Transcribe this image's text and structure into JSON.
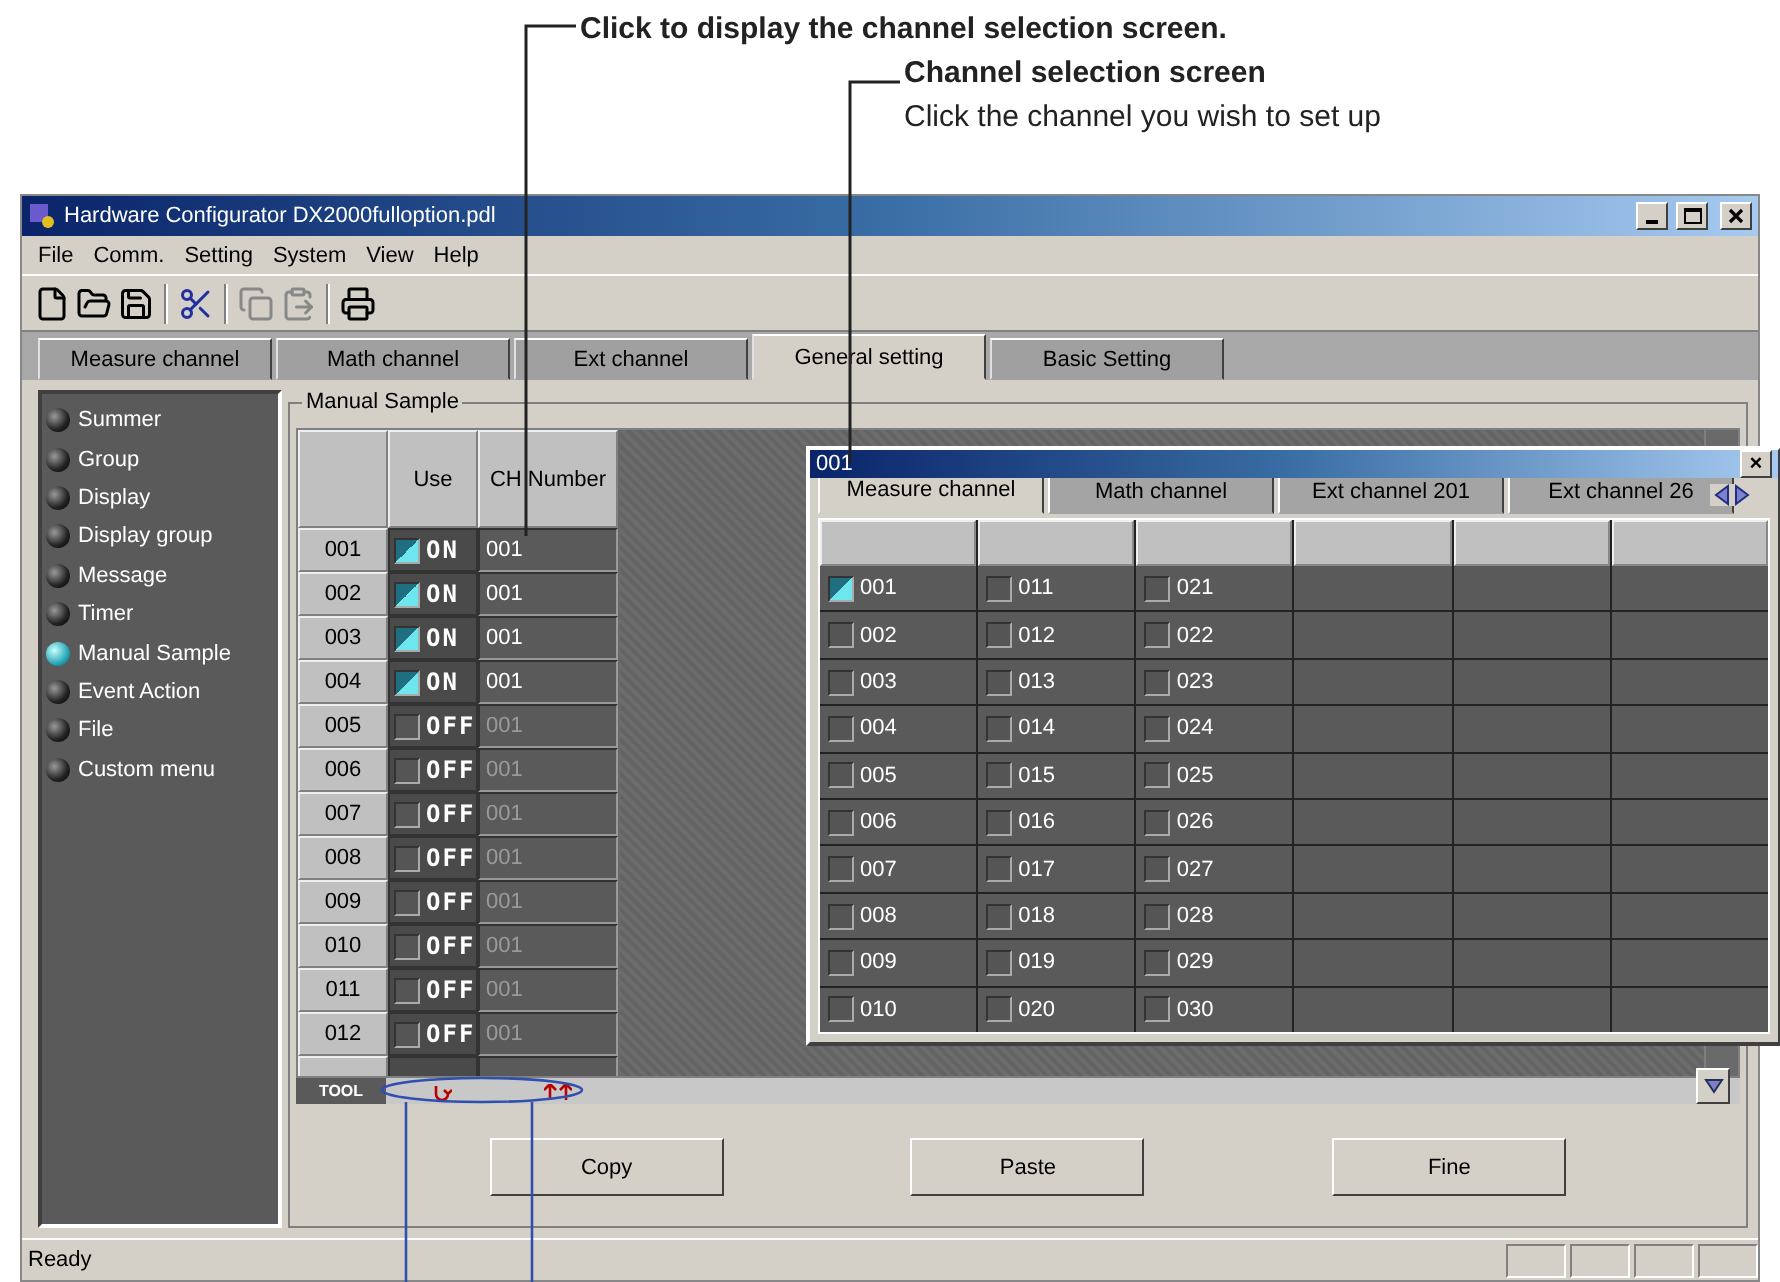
{
  "callouts": [
    {
      "kind": "heading",
      "text": "Click to display the channel selection screen."
    },
    {
      "kind": "heading",
      "text": "Channel selection screen"
    },
    {
      "kind": "body",
      "text": "Click the channel you wish to set up"
    }
  ],
  "window": {
    "title": "Hardware Configurator DX2000fulloption.pdl",
    "menu": [
      "File",
      "Comm.",
      "Setting",
      "System",
      "View",
      "Help"
    ],
    "tabs": [
      {
        "label": "Measure channel",
        "selected": false
      },
      {
        "label": "Math channel",
        "selected": false
      },
      {
        "label": "Ext channel",
        "selected": false
      },
      {
        "label": "General setting",
        "selected": true
      },
      {
        "label": "Basic Setting",
        "selected": false
      }
    ],
    "sidebar": {
      "items": [
        {
          "label": "Summer",
          "selected": false
        },
        {
          "label": "Group",
          "selected": false
        },
        {
          "label": "Display",
          "selected": false
        },
        {
          "label": "Display group",
          "selected": false
        },
        {
          "label": "Message",
          "selected": false
        },
        {
          "label": "Timer",
          "selected": false
        },
        {
          "label": "Manual Sample",
          "selected": true
        },
        {
          "label": "Event Action",
          "selected": false
        },
        {
          "label": "File",
          "selected": false
        },
        {
          "label": "Custom menu",
          "selected": false
        }
      ]
    },
    "group_title": "Manual Sample",
    "table": {
      "columns": [
        "Use",
        "CH Number"
      ],
      "rows": [
        {
          "id": "001",
          "on": true,
          "use_label": "ON",
          "ch": "001"
        },
        {
          "id": "002",
          "on": true,
          "use_label": "ON",
          "ch": "001"
        },
        {
          "id": "003",
          "on": true,
          "use_label": "ON",
          "ch": "001"
        },
        {
          "id": "004",
          "on": true,
          "use_label": "ON",
          "ch": "001"
        },
        {
          "id": "005",
          "on": false,
          "use_label": "OFF",
          "ch": "001"
        },
        {
          "id": "006",
          "on": false,
          "use_label": "OFF",
          "ch": "001"
        },
        {
          "id": "007",
          "on": false,
          "use_label": "OFF",
          "ch": "001"
        },
        {
          "id": "008",
          "on": false,
          "use_label": "OFF",
          "ch": "001"
        },
        {
          "id": "009",
          "on": false,
          "use_label": "OFF",
          "ch": "001"
        },
        {
          "id": "010",
          "on": false,
          "use_label": "OFF",
          "ch": "001"
        },
        {
          "id": "011",
          "on": false,
          "use_label": "OFF",
          "ch": "001"
        },
        {
          "id": "012",
          "on": false,
          "use_label": "OFF",
          "ch": "001"
        }
      ],
      "tool_label": "TOOL"
    },
    "buttons": [
      "Copy",
      "Paste",
      "Fine"
    ],
    "status_bar": "Ready"
  },
  "popup": {
    "title": "001",
    "close": "×",
    "tabs": [
      {
        "label": "Measure channel",
        "selected": true
      },
      {
        "label": "Math channel",
        "selected": false
      },
      {
        "label": "Ext channel 201",
        "selected": false
      },
      {
        "label": "Ext channel 26",
        "selected": false
      }
    ],
    "columns": [
      [
        {
          "label": "001",
          "checked": true
        },
        {
          "label": "002",
          "checked": false
        },
        {
          "label": "003",
          "checked": false
        },
        {
          "label": "004",
          "checked": false
        },
        {
          "label": "005",
          "checked": false
        },
        {
          "label": "006",
          "checked": false
        },
        {
          "label": "007",
          "checked": false
        },
        {
          "label": "008",
          "checked": false
        },
        {
          "label": "009",
          "checked": false
        },
        {
          "label": "010",
          "checked": false
        }
      ],
      [
        {
          "label": "011",
          "checked": false
        },
        {
          "label": "012",
          "checked": false
        },
        {
          "label": "013",
          "checked": false
        },
        {
          "label": "014",
          "checked": false
        },
        {
          "label": "015",
          "checked": false
        },
        {
          "label": "016",
          "checked": false
        },
        {
          "label": "017",
          "checked": false
        },
        {
          "label": "018",
          "checked": false
        },
        {
          "label": "019",
          "checked": false
        },
        {
          "label": "020",
          "checked": false
        }
      ],
      [
        {
          "label": "021",
          "checked": false
        },
        {
          "label": "022",
          "checked": false
        },
        {
          "label": "023",
          "checked": false
        },
        {
          "label": "024",
          "checked": false
        },
        {
          "label": "025",
          "checked": false
        },
        {
          "label": "026",
          "checked": false
        },
        {
          "label": "027",
          "checked": false
        },
        {
          "label": "028",
          "checked": false
        },
        {
          "label": "029",
          "checked": false
        },
        {
          "label": "030",
          "checked": false
        }
      ]
    ]
  }
}
